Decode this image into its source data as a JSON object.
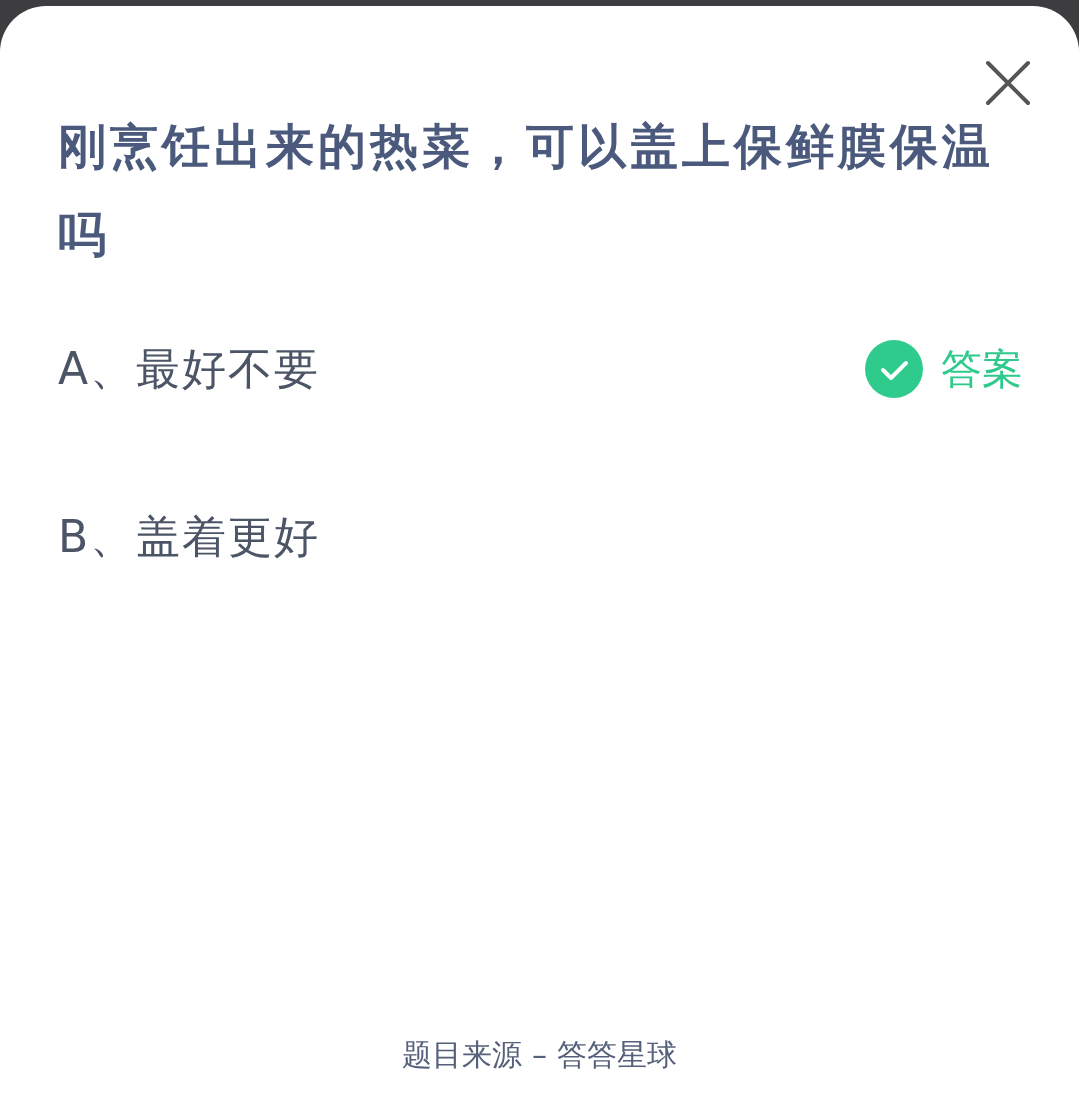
{
  "question": "刚烹饪出来的热菜，可以盖上保鲜膜保温吗",
  "options": [
    {
      "label": "A、最好不要",
      "correct": true
    },
    {
      "label": "B、盖着更好",
      "correct": false
    }
  ],
  "answer_label": "答案",
  "footer": "题目来源 – 答答星球"
}
